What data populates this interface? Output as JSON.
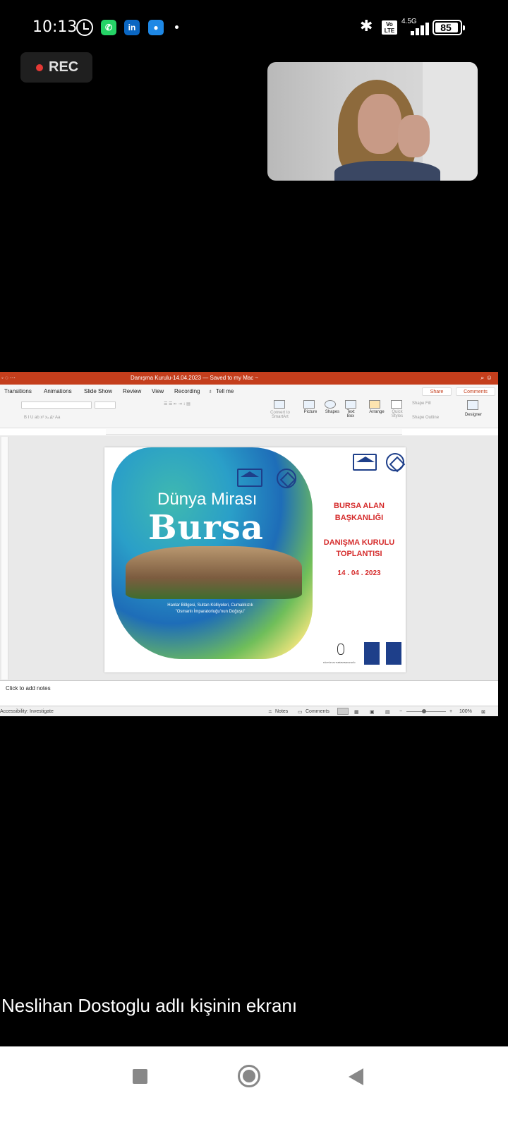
{
  "status_bar": {
    "time": "10:13",
    "network": "4.5G",
    "volte": "Vo LTE",
    "battery": "85"
  },
  "rec": {
    "label": "REC"
  },
  "ppt": {
    "title": "Danışma Kurulu-14.04.2023 — Saved to my Mac ~",
    "menu": [
      "Transitions",
      "Animations",
      "Slide Show",
      "Review",
      "View",
      "Recording",
      "Tell me"
    ],
    "share": "Share",
    "comments": "Comments",
    "ribbon": {
      "convert": "Convert to SmartArt",
      "picture": "Picture",
      "shapes": "Shapes",
      "textbox": "Text Box",
      "arrange": "Arrange",
      "quick_styles": "Quick Styles",
      "shape_fill": "Shape Fill",
      "shape_outline": "Shape Outline",
      "designer": "Designer"
    },
    "slide": {
      "dunya": "Dünya Mirası",
      "bursa": "Bursa",
      "subtitle1": "Hanlar Bölgesi, Sultan Külliyeleri, Cumalıkızık",
      "subtitle2": "\"Osmanlı İmparatorluğu'nun Doğuşu\"",
      "line1": "BURSA ALAN",
      "line2": "BAŞKANLIĞI",
      "line3": "DANIŞMA KURULU",
      "line4": "TOPLANTISI",
      "date": "14 . 04 . 2023",
      "ministry": "KÜLTÜR VE TURİZM BAKANLIĞI"
    },
    "notes": "Click to add notes",
    "status": {
      "accessibility": "Accessibility: Investigate",
      "notes": "Notes",
      "comments": "Comments",
      "zoom": "100%"
    }
  },
  "share_caption": "Neslihan Dostoglu adlı kişinin ekranı"
}
